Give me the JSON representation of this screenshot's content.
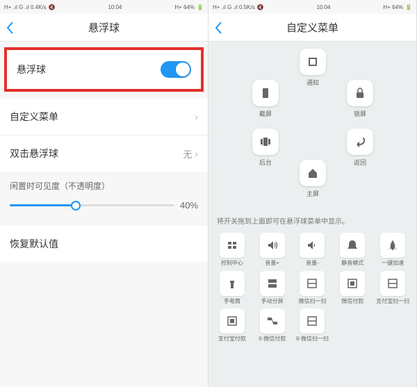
{
  "statusbar": {
    "left1": "H+ .ıl G .ıl 0.4K/s",
    "left2": "H+ .ıl G .ıl 0.5K/s",
    "time": "10:04",
    "battery": "H+ 64%"
  },
  "left": {
    "title": "悬浮球",
    "main_toggle_label": "悬浮球",
    "custom_menu": "自定义菜单",
    "double_tap": "双击悬浮球",
    "double_tap_value": "无",
    "opacity_label": "闲置时可见度（不透明度）",
    "opacity_value": "40%",
    "reset": "恢复默认值"
  },
  "right": {
    "title": "自定义菜单",
    "menu_items": [
      {
        "label": "通知"
      },
      {
        "label": "截屏"
      },
      {
        "label": "锁屏"
      },
      {
        "label": "后台"
      },
      {
        "label": "返回"
      },
      {
        "label": "主屏"
      }
    ],
    "instruction": "将开关拖到上面即可在悬浮球菜单中显示。",
    "toggles": [
      {
        "label": "控制中心"
      },
      {
        "label": "音量+"
      },
      {
        "label": "音量-"
      },
      {
        "label": "静音模式"
      },
      {
        "label": "一键加速"
      },
      {
        "label": "手电筒"
      },
      {
        "label": "手动分屏"
      },
      {
        "label": "微信扫一扫"
      },
      {
        "label": "微信付款"
      },
      {
        "label": "支付宝扫一扫"
      },
      {
        "label": "支付宝付款"
      },
      {
        "label": "II·微信付款"
      },
      {
        "label": "II·微信扫一扫"
      }
    ]
  }
}
